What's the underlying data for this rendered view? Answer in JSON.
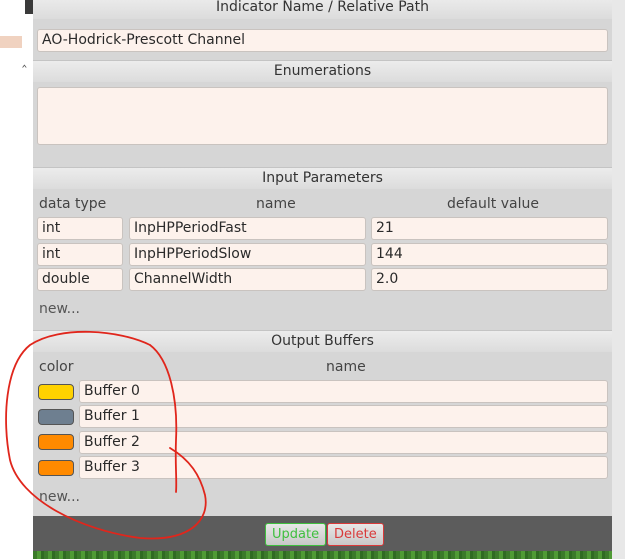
{
  "indicator_section": {
    "header": "Indicator Name / Relative Path",
    "name_value": "AO-Hodrick-Prescott Channel"
  },
  "enumerations": {
    "header": "Enumerations",
    "value": ""
  },
  "input_parameters": {
    "header": "Input Parameters",
    "columns": {
      "type": "data type",
      "name": "name",
      "default": "default value"
    },
    "rows": [
      {
        "type": "int",
        "name": "InpHPPeriodFast",
        "default": "21"
      },
      {
        "type": "int",
        "name": "InpHPPeriodSlow",
        "default": "144"
      },
      {
        "type": "double",
        "name": "ChannelWidth",
        "default": "2.0"
      }
    ],
    "new_label": "new..."
  },
  "output_buffers": {
    "header": "Output Buffers",
    "columns": {
      "color": "color",
      "name": "name"
    },
    "rows": [
      {
        "color": "#ffd200",
        "name": "Buffer 0"
      },
      {
        "color": "#6e7f90",
        "name": "Buffer 1"
      },
      {
        "color": "#ff8a00",
        "name": "Buffer 2"
      },
      {
        "color": "#ff8a00",
        "name": "Buffer 3"
      }
    ],
    "new_label": "new..."
  },
  "footer": {
    "update_label": "Update",
    "delete_label": "Delete"
  },
  "icons": {
    "left_chevron": "chevron-icon"
  },
  "colors": {
    "panel_bg": "#d6d6d6",
    "field_bg": "#fdf2ec",
    "annotation": "#e0261c",
    "update": "#3fbf3f",
    "delete": "#d93a3a"
  }
}
